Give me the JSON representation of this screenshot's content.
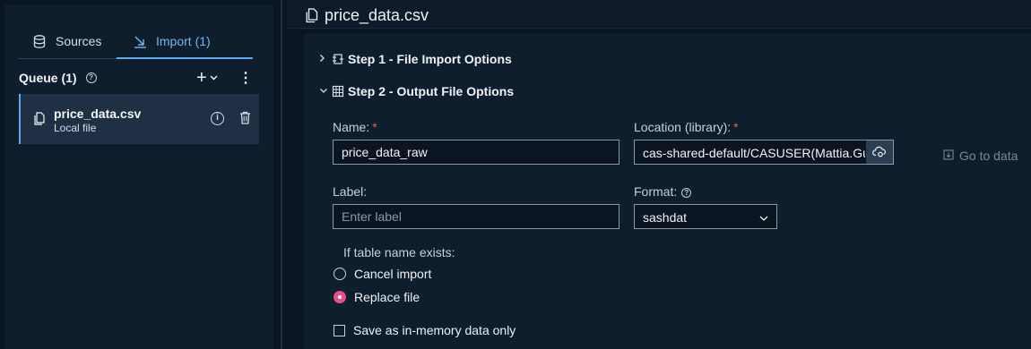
{
  "left_panel": {
    "tabs": [
      {
        "label": "Sources",
        "icon": "database-icon"
      },
      {
        "label": "Import (1)",
        "icon": "import-arrow-icon",
        "active": true
      }
    ],
    "queue": {
      "title": "Queue (1)",
      "items": [
        {
          "name": "price_data.csv",
          "subtitle": "Local file"
        }
      ]
    }
  },
  "header": {
    "title": "price_data.csv"
  },
  "steps": [
    {
      "label": "Step 1 - File Import Options",
      "expanded": false
    },
    {
      "label": "Step 2 - Output File Options",
      "expanded": true
    }
  ],
  "form": {
    "name_label": "Name:",
    "name_value": "price_data_raw",
    "location_label": "Location (library):",
    "location_value": "cas-shared-default/CASUSER(Mattia.Gu...",
    "goto_label": "Go to data",
    "label_label": "Label:",
    "label_placeholder": "Enter label",
    "format_label": "Format:",
    "format_value": "sashdat",
    "table_exists_label": "If table name exists:",
    "radio_options": [
      {
        "label": "Cancel import",
        "checked": false
      },
      {
        "label": "Replace file",
        "checked": true
      }
    ],
    "checkbox_label": "Save as in-memory data only",
    "checkbox_checked": false
  },
  "colors": {
    "accent": "#5aa8f0",
    "radio_selected": "#e64f8e",
    "required": "#f05a5a"
  }
}
